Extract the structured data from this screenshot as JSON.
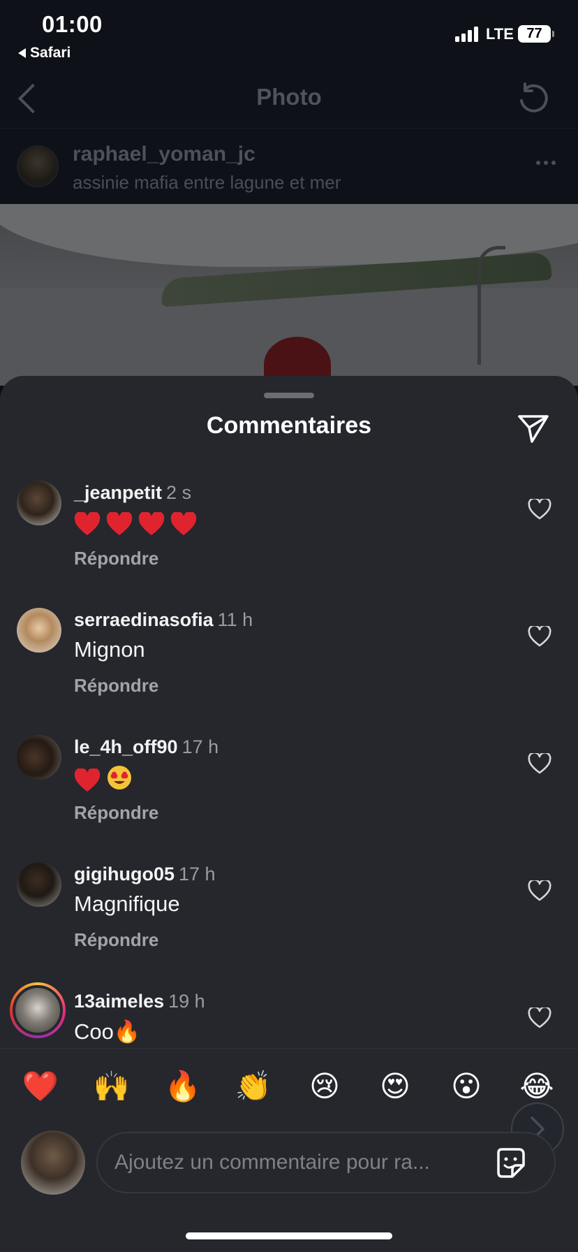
{
  "status_bar": {
    "time": "01:00",
    "back_app": "Safari",
    "network": "LTE",
    "battery": "77"
  },
  "header": {
    "title": "Photo"
  },
  "post": {
    "username": "raphael_yoman_jc",
    "location": "assinie mafia entre lagune et mer"
  },
  "comments_sheet": {
    "title": "Commentaires",
    "reply_label": "Répondre",
    "comments": [
      {
        "username": "_jeanpetit",
        "time": "2 s",
        "text": "❤️❤️❤️❤️"
      },
      {
        "username": "serraedinasofia",
        "time": "11 h",
        "text": "Mignon"
      },
      {
        "username": "le_4h_off90",
        "time": "17 h",
        "text": "❤️😍"
      },
      {
        "username": "gigihugo05",
        "time": "17 h",
        "text": "Magnifique"
      },
      {
        "username": "13aimeles",
        "time": "19 h",
        "text": "Coo🔥"
      }
    ]
  },
  "quick_reactions": [
    "❤️",
    "🙌",
    "🔥",
    "👏",
    "😢",
    "😍",
    "😮",
    "😂"
  ],
  "composer": {
    "placeholder": "Ajoutez un commentaire pour ra..."
  },
  "colors": {
    "sheet_bg": "#25272d",
    "heart_red": "#e0242f",
    "secondary_text": "#9a9ca2"
  },
  "icons": [
    "chevron-left-icon",
    "refresh-icon",
    "more-icon",
    "send-icon",
    "heart-outline-icon",
    "sticker-icon",
    "chevron-right-icon"
  ]
}
